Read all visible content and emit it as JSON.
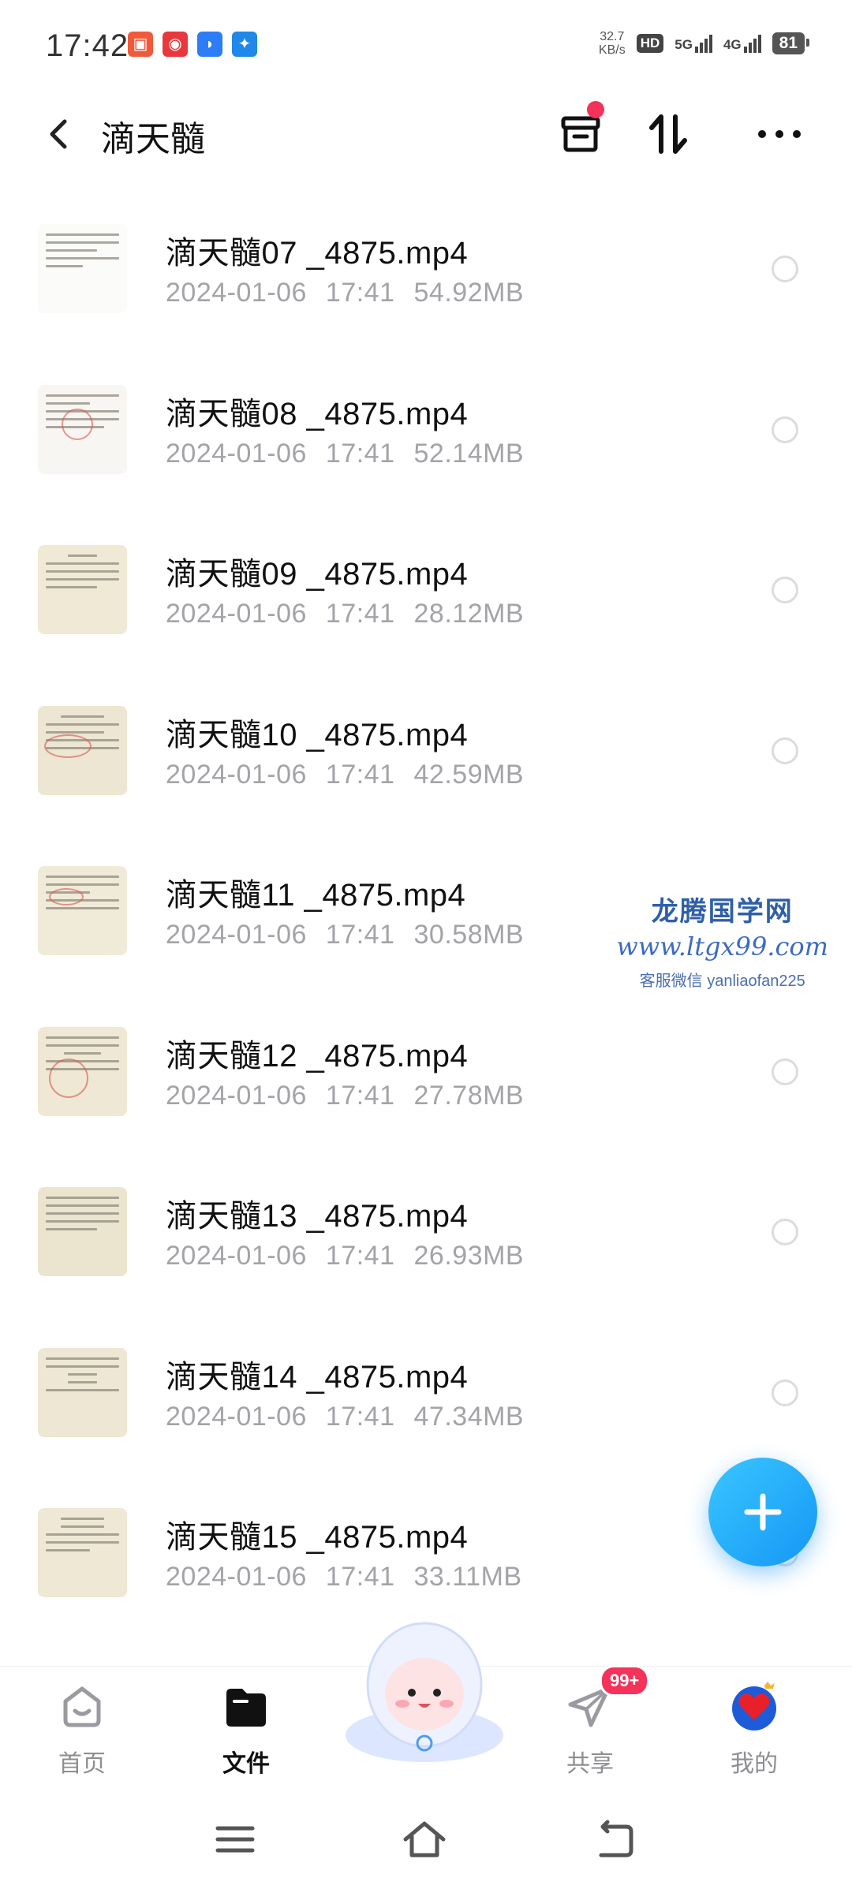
{
  "status_bar": {
    "time": "17:42",
    "speed_value": "32.7",
    "speed_unit": "KB/s",
    "hd": "HD",
    "net1": "5G",
    "net2": "4G",
    "battery": "81"
  },
  "header": {
    "title": "滴天髓"
  },
  "files": [
    {
      "name": "滴天髓07 _4875.mp4",
      "date": "2024-01-06",
      "time": "17:41",
      "size": "54.92MB"
    },
    {
      "name": "滴天髓08 _4875.mp4",
      "date": "2024-01-06",
      "time": "17:41",
      "size": "52.14MB"
    },
    {
      "name": "滴天髓09 _4875.mp4",
      "date": "2024-01-06",
      "time": "17:41",
      "size": "28.12MB"
    },
    {
      "name": "滴天髓10 _4875.mp4",
      "date": "2024-01-06",
      "time": "17:41",
      "size": "42.59MB"
    },
    {
      "name": "滴天髓11 _4875.mp4",
      "date": "2024-01-06",
      "time": "17:41",
      "size": "30.58MB"
    },
    {
      "name": "滴天髓12 _4875.mp4",
      "date": "2024-01-06",
      "time": "17:41",
      "size": "27.78MB"
    },
    {
      "name": "滴天髓13 _4875.mp4",
      "date": "2024-01-06",
      "time": "17:41",
      "size": "26.93MB"
    },
    {
      "name": "滴天髓14 _4875.mp4",
      "date": "2024-01-06",
      "time": "17:41",
      "size": "47.34MB"
    },
    {
      "name": "滴天髓15 _4875.mp4",
      "date": "2024-01-06",
      "time": "17:41",
      "size": "33.11MB"
    }
  ],
  "watermark": {
    "name": "龙腾国学网",
    "url": "www.ltgx99.com",
    "contact": "客服微信 yanliaofan225"
  },
  "tabs": {
    "home": "首页",
    "files": "文件",
    "share": "共享",
    "share_badge": "99+",
    "mine": "我的"
  },
  "colors": {
    "accent": "#1497f5",
    "badge": "#f4325a"
  }
}
